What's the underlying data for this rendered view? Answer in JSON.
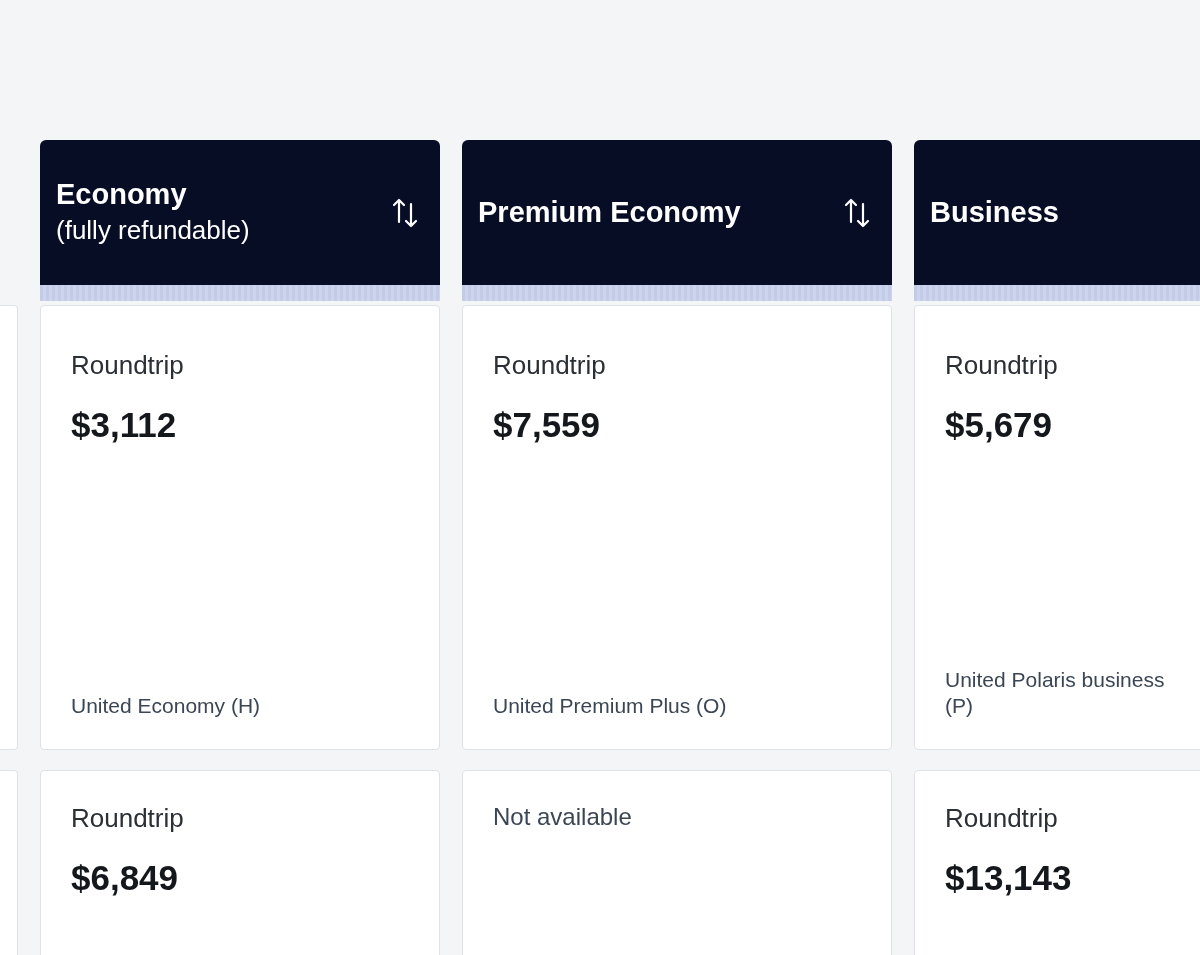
{
  "columns": [
    {
      "title": "Economy",
      "note": "(fully refundable)",
      "sort_icon": true
    },
    {
      "title": "Premium Economy",
      "sort_icon": true
    },
    {
      "title": "Business",
      "sort_icon": false
    }
  ],
  "rows": [
    {
      "cells": [
        {
          "kind": "fare",
          "trip": "Roundtrip",
          "price": "$3,112",
          "fare_class": "United Economy (H)"
        },
        {
          "kind": "fare",
          "trip": "Roundtrip",
          "price": "$7,559",
          "fare_class": "United Premium Plus (O)"
        },
        {
          "kind": "fare",
          "trip": "Roundtrip",
          "price": "$5,679",
          "fare_class": "United Polaris business (P)"
        }
      ]
    },
    {
      "cells": [
        {
          "kind": "fare",
          "trip": "Roundtrip",
          "price": "$6,849"
        },
        {
          "kind": "unavailable",
          "text": "Not available"
        },
        {
          "kind": "fare",
          "trip": "Roundtrip",
          "price": "$13,143"
        }
      ]
    }
  ]
}
